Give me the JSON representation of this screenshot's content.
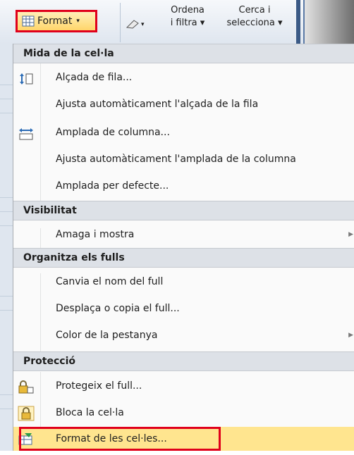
{
  "ribbon": {
    "format_label": "Format",
    "sort_line1": "Ordena",
    "sort_line2": "i filtra ▾",
    "find_line1": "Cerca i",
    "find_line2": "selecciona ▾"
  },
  "menu": {
    "sections": [
      {
        "header": "Mida de la cel·la"
      },
      {
        "header": "Visibilitat"
      },
      {
        "header": "Organitza els fulls"
      },
      {
        "header": "Protecció"
      }
    ],
    "items": {
      "row_height": "Alçada de fila...",
      "autofit_row": "Ajusta automàticament l'alçada de la fila",
      "column_width": "Amplada de columna...",
      "autofit_column": "Ajusta automàticament l'amplada de la columna",
      "default_width": "Amplada per defecte...",
      "hide_unhide": "Amaga i mostra",
      "rename_sheet": "Canvia el nom del full",
      "move_copy_sheet": "Desplaça o copia el full...",
      "tab_color": "Color de la pestanya",
      "protect_sheet": "Protegeix el full...",
      "lock_cell": "Bloca la cel·la",
      "format_cells": "Format de les cel·les..."
    }
  },
  "colors": {
    "highlight": "#ffe58f",
    "outline": "#e0001b",
    "header_bg": "#dde1e7"
  }
}
